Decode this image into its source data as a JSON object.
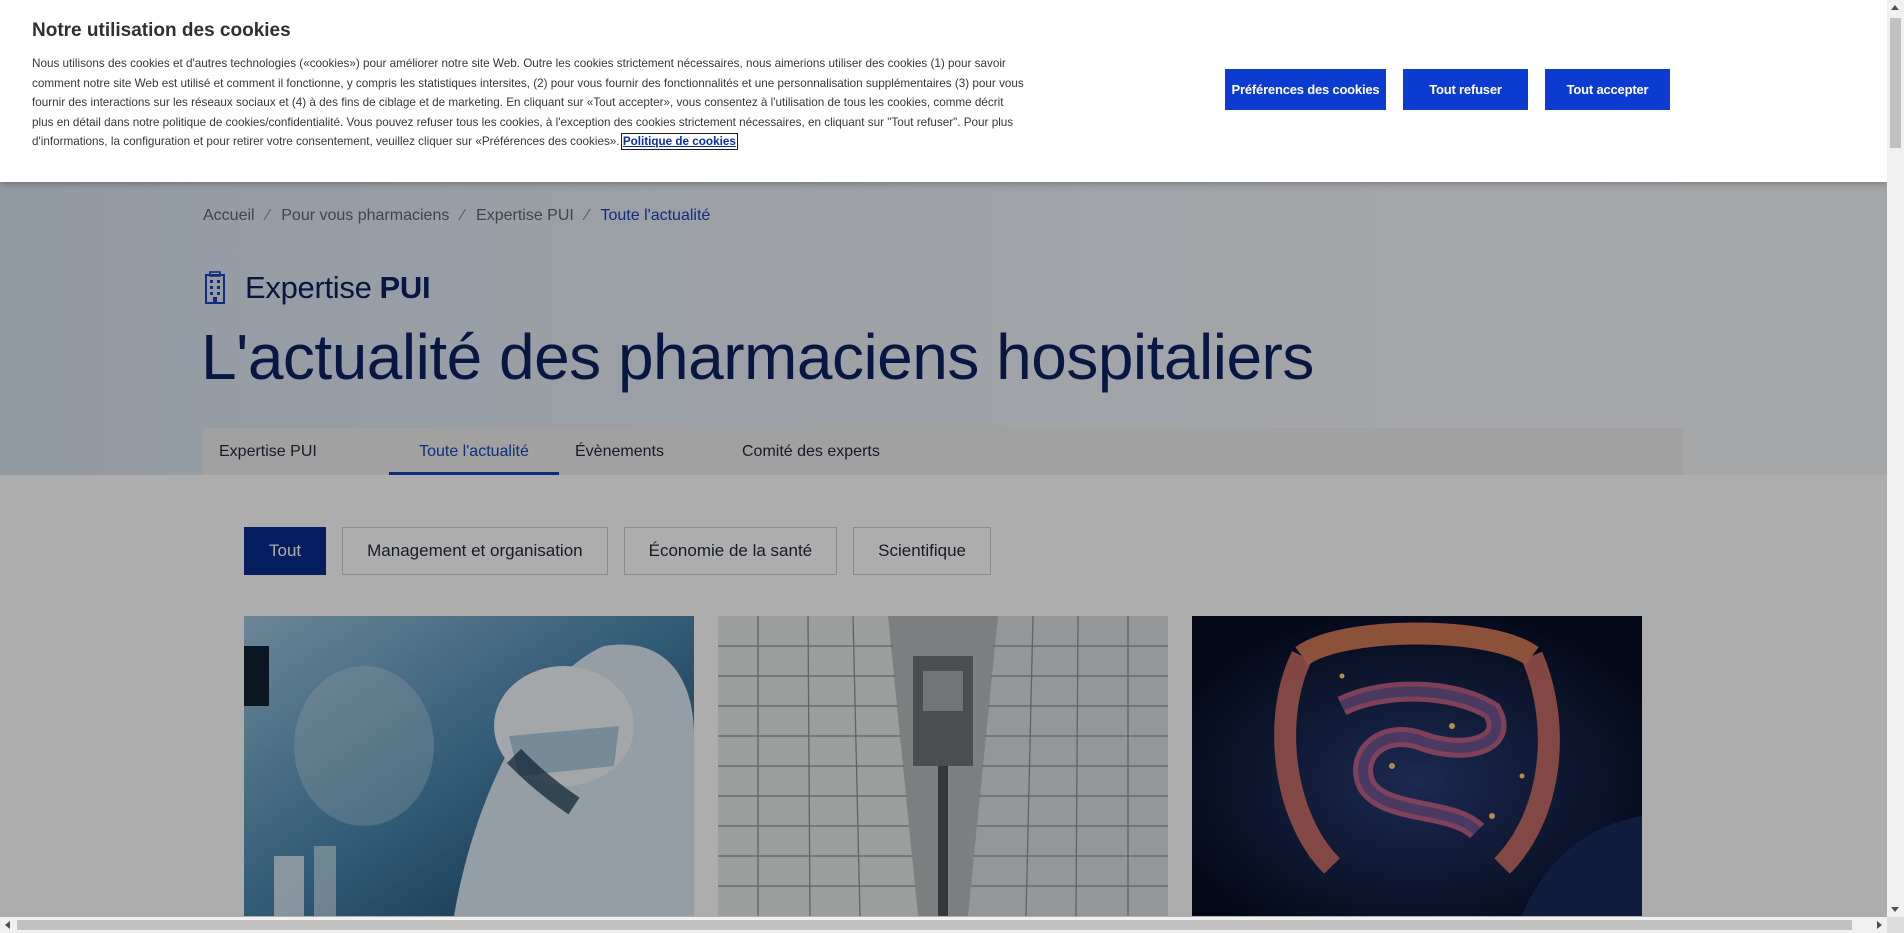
{
  "cookie_banner": {
    "title": "Notre utilisation des cookies",
    "body": "Nous utilisons des cookies et d'autres technologies («cookies») pour améliorer notre site Web. Outre les cookies strictement nécessaires, nous aimerions utiliser des cookies (1) pour savoir comment notre site Web est utilisé et comment il fonctionne, y compris les statistiques intersites, (2) pour vous fournir des fonctionnalités et une personnalisation supplémentaires (3) pour vous fournir des interactions sur les réseaux sociaux et (4) à des fins de ciblage et de marketing. En cliquant sur «Tout accepter», vous consentez à l'utilisation de tous les cookies, comme décrit plus en détail dans notre politique de cookies/confidentialité. Vous pouvez refuser tous les cookies, à l'exception des cookies strictement nécessaires, en cliquant sur \"Tout refuser\". Pour plus d'informations, la configuration et pour retirer votre consentement, veuillez cliquer sur «Préférences des cookies».",
    "policy_link": "Politique de cookies",
    "buttons": {
      "preferences": "Préférences des cookies",
      "reject_all": "Tout refuser",
      "accept_all": "Tout accepter"
    }
  },
  "breadcrumb": {
    "items": [
      "Accueil",
      "Pour vous pharmaciens",
      "Expertise PUI",
      "Toute l'actualité"
    ],
    "separator": "⁄"
  },
  "section": {
    "label_regular": "Expertise",
    "label_bold": "PUI",
    "icon": "hospital-building-icon"
  },
  "page_title": "L'actualité des pharmaciens hospitaliers",
  "tabs": [
    {
      "label": "Expertise PUI",
      "active": false
    },
    {
      "label": "Toute l'actualité",
      "active": true
    },
    {
      "label": "Évènements",
      "active": false
    },
    {
      "label": "Comité des experts",
      "active": false
    }
  ],
  "filters": [
    {
      "label": "Tout",
      "active": true
    },
    {
      "label": "Management et organisation",
      "active": false
    },
    {
      "label": "Économie de la santé",
      "active": false
    },
    {
      "label": "Scientifique",
      "active": false
    }
  ],
  "cards": [
    {
      "image": "lab-researcher-image"
    },
    {
      "image": "pharmacy-robot-storage-image"
    },
    {
      "image": "glowing-intestine-image"
    }
  ],
  "colors": {
    "accent": "#1544b8",
    "button": "#0b3bd0",
    "title": "#0c2262",
    "active_chip": "#0a2b8c"
  }
}
